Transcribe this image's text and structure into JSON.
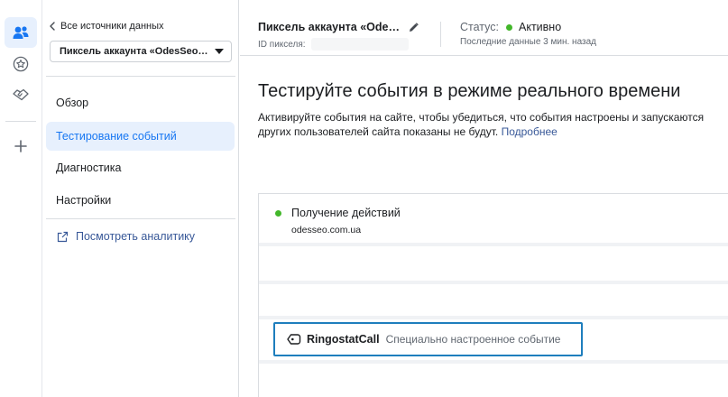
{
  "sidebar": {
    "back_label": "Все источники данных",
    "pixel_select": "Пиксель аккаунта «OdesSeo…",
    "nav": [
      {
        "label": "Обзор",
        "active": false
      },
      {
        "label": "Тестирование событий",
        "active": true
      },
      {
        "label": "Диагностика",
        "active": false
      },
      {
        "label": "Настройки",
        "active": false
      }
    ],
    "analytics_link": "Посмотреть аналитику"
  },
  "header": {
    "pixel_name": "Пиксель аккаунта «Ode…",
    "pixel_id_label": "ID пикселя:",
    "status_label": "Статус:",
    "status_value": "Активно",
    "last_data": "Последние данные 3 мин. назад"
  },
  "main": {
    "title": "Тестируйте события в режиме реального времени",
    "description_line1": "Активируйте события на сайте, чтобы убедиться, что события настроены и запускаются",
    "description_line2": "других пользователей сайта показаны не будут.",
    "more_link": "Подробнее"
  },
  "events": {
    "receiving_title": "Получение действий",
    "domain": "odesseo.com.ua",
    "event_name": "RingostatCall",
    "event_type": "Специально настроенное событие"
  },
  "colors": {
    "accent": "#1877f2",
    "active_bg": "#e7f0fd",
    "status_green": "#42b72a",
    "link": "#385898",
    "highlight_border": "#1e7ebd"
  },
  "icons": {
    "rail": [
      "people-icon",
      "star-badge-icon",
      "handshake-icon",
      "plus-icon"
    ],
    "back": "chevron-left-icon",
    "dropdown": "caret-down-icon",
    "edit": "pencil-icon",
    "external": "external-link-icon",
    "event": "tag-icon"
  }
}
